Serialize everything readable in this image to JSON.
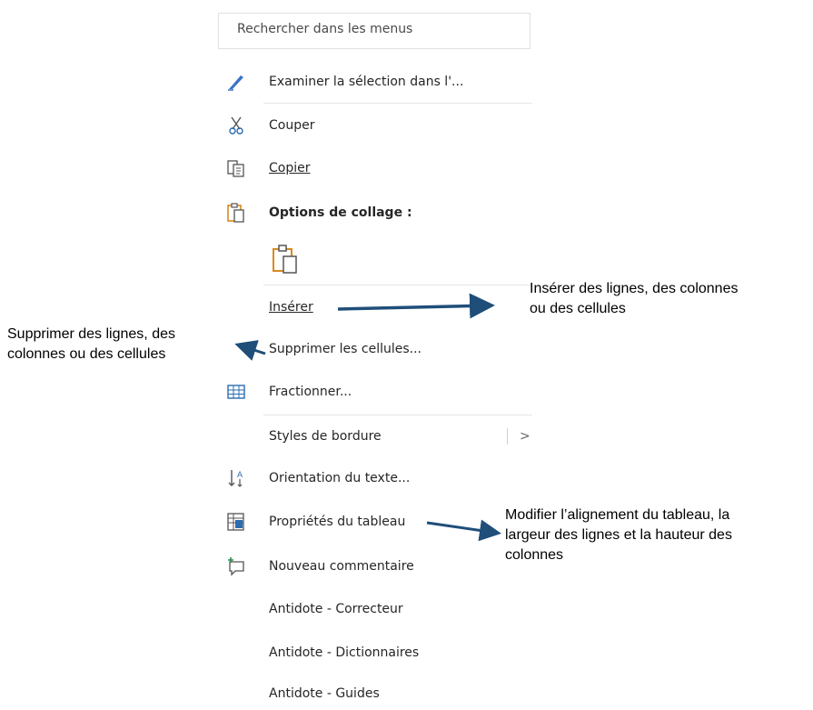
{
  "menu": {
    "search_placeholder": "Rechercher dans les menus",
    "items": {
      "examiner": {
        "label": "Examiner la sélection dans l'...",
        "icon": "pen-feather-icon"
      },
      "couper": {
        "label": "Couper",
        "icon": "scissors-icon"
      },
      "copier": {
        "label": "Copier",
        "icon": "copy-icon"
      },
      "options_collage": {
        "label": "Options de collage :",
        "icon": "paste-icon"
      },
      "inserer": {
        "label": "Insérer"
      },
      "supprimer": {
        "label": "Supprimer les cellules..."
      },
      "fractionner": {
        "label": "Fractionner...",
        "icon": "split-cells-icon"
      },
      "styles_bordure": {
        "label": "Styles de bordure",
        "chevron": ">"
      },
      "orientation": {
        "label": "Orientation du texte...",
        "icon": "text-direction-icon"
      },
      "proprietes": {
        "label": "Propriétés du tableau",
        "icon": "table-properties-icon"
      },
      "nouveau_commentaire": {
        "label": "Nouveau commentaire",
        "icon": "new-comment-icon"
      },
      "antidote_correcteur": {
        "label": "Antidote - Correcteur"
      },
      "antidote_dictionnaires": {
        "label": "Antidote - Dictionnaires"
      },
      "antidote_guides": {
        "label": "Antidote - Guides"
      }
    }
  },
  "annotations": {
    "inserer": [
      "Insérer des lignes, des colonnes",
      "ou des cellules"
    ],
    "supprimer": [
      "Supprimer des lignes, des",
      "colonnes ou des cellules"
    ],
    "proprietes": [
      "Modifier l’alignement du tableau, la",
      "largeur des lignes et la hauteur des",
      "colonnes"
    ]
  },
  "colors": {
    "arrow": "#1f4e79",
    "icon_blue": "#2b6cb0",
    "icon_orange": "#d98a1f",
    "icon_green": "#2e8b57"
  }
}
